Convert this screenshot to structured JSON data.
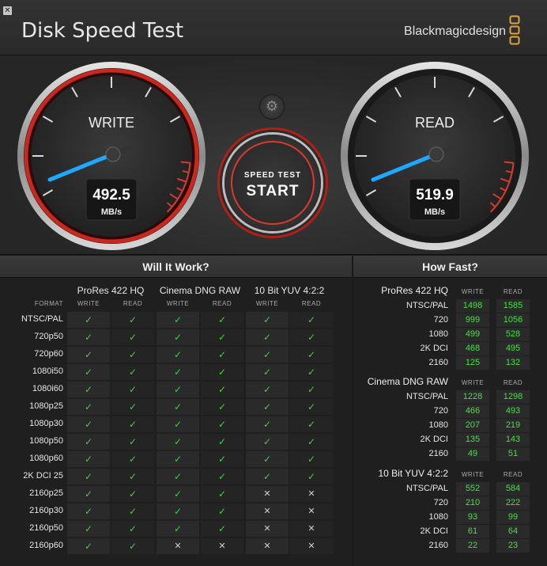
{
  "window": {
    "close_glyph": "✕"
  },
  "app": {
    "title": "Disk Speed Test",
    "brand": "Blackmagicdesign"
  },
  "gauges": {
    "write": {
      "label": "WRITE",
      "value": "492.5",
      "unit": "MB/s"
    },
    "read": {
      "label": "READ",
      "value": "519.9",
      "unit": "MB/s"
    }
  },
  "controls": {
    "settings_icon": "gear-icon",
    "start_small": "SPEED TEST",
    "start_big": "START"
  },
  "colors": {
    "ok": "#3cd33c",
    "needle": "#1fa8ff",
    "accent_red": "#c8281e"
  },
  "will_it_work": {
    "title": "Will It Work?",
    "format_header": "FORMAT",
    "groups": [
      {
        "name": "ProRes 422 HQ",
        "sub": [
          "WRITE",
          "READ"
        ]
      },
      {
        "name": "Cinema DNG RAW",
        "sub": [
          "WRITE",
          "READ"
        ]
      },
      {
        "name": "10 Bit YUV 4:2:2",
        "sub": [
          "WRITE",
          "READ"
        ]
      }
    ],
    "check_glyph": "✓",
    "cross_glyph": "✕",
    "rows": [
      {
        "format": "NTSC/PAL",
        "cells": [
          1,
          1,
          1,
          1,
          1,
          1
        ]
      },
      {
        "format": "720p50",
        "cells": [
          1,
          1,
          1,
          1,
          1,
          1
        ]
      },
      {
        "format": "720p60",
        "cells": [
          1,
          1,
          1,
          1,
          1,
          1
        ]
      },
      {
        "format": "1080i50",
        "cells": [
          1,
          1,
          1,
          1,
          1,
          1
        ]
      },
      {
        "format": "1080i60",
        "cells": [
          1,
          1,
          1,
          1,
          1,
          1
        ]
      },
      {
        "format": "1080p25",
        "cells": [
          1,
          1,
          1,
          1,
          1,
          1
        ]
      },
      {
        "format": "1080p30",
        "cells": [
          1,
          1,
          1,
          1,
          1,
          1
        ]
      },
      {
        "format": "1080p50",
        "cells": [
          1,
          1,
          1,
          1,
          1,
          1
        ]
      },
      {
        "format": "1080p60",
        "cells": [
          1,
          1,
          1,
          1,
          1,
          1
        ]
      },
      {
        "format": "2K DCI 25",
        "cells": [
          1,
          1,
          1,
          1,
          1,
          1
        ]
      },
      {
        "format": "2160p25",
        "cells": [
          1,
          1,
          1,
          1,
          0,
          0
        ]
      },
      {
        "format": "2160p30",
        "cells": [
          1,
          1,
          1,
          1,
          0,
          0
        ]
      },
      {
        "format": "2160p50",
        "cells": [
          1,
          1,
          1,
          1,
          0,
          0
        ]
      },
      {
        "format": "2160p60",
        "cells": [
          1,
          1,
          0,
          0,
          0,
          0
        ]
      }
    ]
  },
  "how_fast": {
    "title": "How Fast?",
    "col_write": "WRITE",
    "col_read": "READ",
    "sections": [
      {
        "name": "ProRes 422 HQ",
        "rows": [
          {
            "label": "NTSC/PAL",
            "write": "1498",
            "read": "1585"
          },
          {
            "label": "720",
            "write": "999",
            "read": "1056"
          },
          {
            "label": "1080",
            "write": "499",
            "read": "528"
          },
          {
            "label": "2K DCI",
            "write": "468",
            "read": "495"
          },
          {
            "label": "2160",
            "write": "125",
            "read": "132"
          }
        ]
      },
      {
        "name": "Cinema DNG RAW",
        "rows": [
          {
            "label": "NTSC/PAL",
            "write": "1228",
            "read": "1298"
          },
          {
            "label": "720",
            "write": "466",
            "read": "493"
          },
          {
            "label": "1080",
            "write": "207",
            "read": "219"
          },
          {
            "label": "2K DCI",
            "write": "135",
            "read": "143"
          },
          {
            "label": "2160",
            "write": "49",
            "read": "51"
          }
        ]
      },
      {
        "name": "10 Bit YUV 4:2:2",
        "rows": [
          {
            "label": "NTSC/PAL",
            "write": "552",
            "read": "584"
          },
          {
            "label": "720",
            "write": "210",
            "read": "222"
          },
          {
            "label": "1080",
            "write": "93",
            "read": "99"
          },
          {
            "label": "2K DCI",
            "write": "61",
            "read": "64"
          },
          {
            "label": "2160",
            "write": "22",
            "read": "23"
          }
        ]
      }
    ]
  }
}
